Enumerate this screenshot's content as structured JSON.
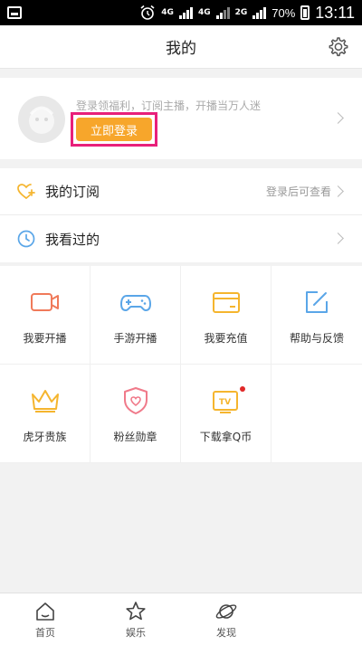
{
  "status_bar": {
    "time": "13:11",
    "battery": "70%",
    "network_1": "4G",
    "network_2": "4G",
    "network_3": "2G"
  },
  "header": {
    "title": "我的"
  },
  "profile": {
    "slogan": "登录领福利，订阅主播，开播当万人迷",
    "login_label": "立即登录"
  },
  "list": [
    {
      "label": "我的订阅",
      "hint": "登录后可查看",
      "icon": "heart-plus-icon"
    },
    {
      "label": "我看过的",
      "hint": "",
      "icon": "clock-icon"
    }
  ],
  "grid": [
    {
      "label": "我要开播",
      "icon": "video-camera-icon",
      "color": "#f07a5a"
    },
    {
      "label": "手游开播",
      "icon": "gamepad-icon",
      "color": "#5aa6e8"
    },
    {
      "label": "我要充值",
      "icon": "wallet-icon",
      "color": "#f5b52e"
    },
    {
      "label": "帮助与反馈",
      "icon": "edit-icon",
      "color": "#5aa6e8"
    },
    {
      "label": "虎牙贵族",
      "icon": "crown-icon",
      "color": "#f5b52e"
    },
    {
      "label": "粉丝勋章",
      "icon": "heart-shield-icon",
      "color": "#f07a8a"
    },
    {
      "label": "下载拿Q币",
      "icon": "tv-icon",
      "color": "#f5b52e"
    }
  ],
  "tabs": [
    {
      "label": "首页",
      "icon": "home-icon"
    },
    {
      "label": "娱乐",
      "icon": "star-icon"
    },
    {
      "label": "发现",
      "icon": "planet-icon"
    }
  ],
  "colors": {
    "accent": "#f7a62b",
    "highlight": "#e8207a",
    "badge": "#e02828"
  }
}
